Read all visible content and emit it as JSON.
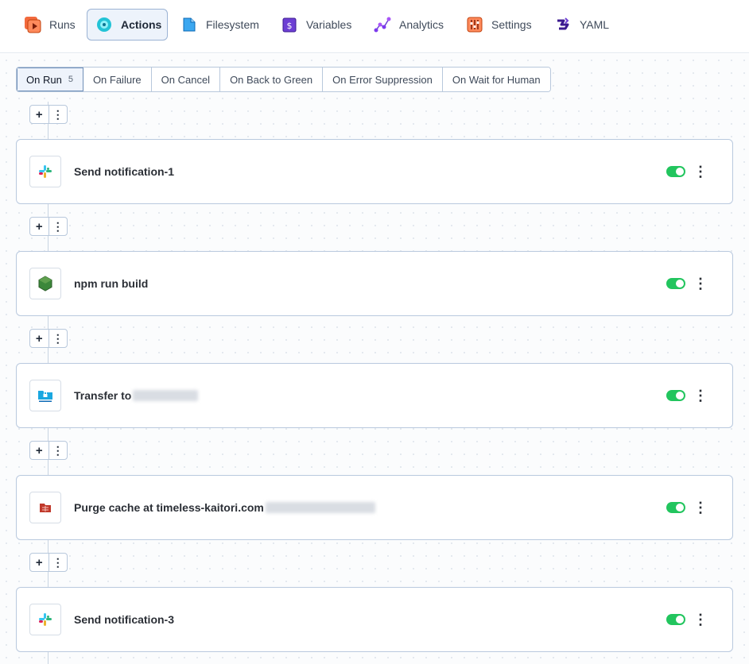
{
  "nav": {
    "items": [
      {
        "label": "Runs",
        "icon": "runs-icon",
        "active": false
      },
      {
        "label": "Actions",
        "icon": "actions-icon",
        "active": true
      },
      {
        "label": "Filesystem",
        "icon": "filesystem-icon",
        "active": false
      },
      {
        "label": "Variables",
        "icon": "variables-icon",
        "active": false
      },
      {
        "label": "Analytics",
        "icon": "analytics-icon",
        "active": false
      },
      {
        "label": "Settings",
        "icon": "settings-icon",
        "active": false
      },
      {
        "label": "YAML",
        "icon": "yaml-icon",
        "active": false
      }
    ]
  },
  "tabs": [
    {
      "label": "On Run",
      "count": "5",
      "active": true
    },
    {
      "label": "On Failure",
      "count": "",
      "active": false
    },
    {
      "label": "On Cancel",
      "count": "",
      "active": false
    },
    {
      "label": "On Back to Green",
      "count": "",
      "active": false
    },
    {
      "label": "On Error Suppression",
      "count": "",
      "active": false
    },
    {
      "label": "On Wait for Human",
      "count": "",
      "active": false
    }
  ],
  "controls": {
    "add_symbol": "+",
    "more_symbol": "⋮"
  },
  "actions": [
    {
      "title": "Send notification-1",
      "icon": "slack-icon",
      "enabled": true,
      "redacted": false
    },
    {
      "title": "npm run build",
      "icon": "nodejs-icon",
      "enabled": true,
      "redacted": false
    },
    {
      "title": "Transfer to",
      "icon": "sftp-transfer-icon",
      "enabled": true,
      "redacted": true
    },
    {
      "title": "Purge cache at timeless-kaitori.com",
      "icon": "cloudflare-purge-icon",
      "enabled": true,
      "redacted": true
    },
    {
      "title": "Send notification-3",
      "icon": "slack-icon",
      "enabled": true,
      "redacted": false
    }
  ],
  "colors": {
    "accent": "#9bb3d4",
    "toggle_on": "#22c55e",
    "border": "#b9c9de"
  }
}
